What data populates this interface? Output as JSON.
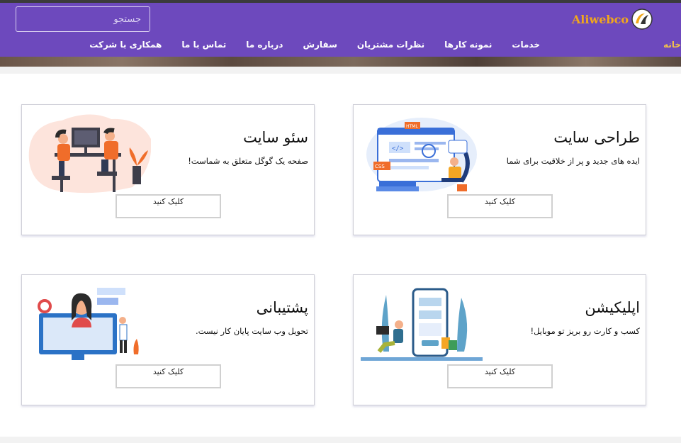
{
  "search": {
    "placeholder": "جستجو"
  },
  "logo": {
    "text": "Aliwebco"
  },
  "nav": {
    "home": "خانه",
    "items": [
      "خدمات",
      "نمونه کارها",
      "نظرات مشتریان",
      "سفارش",
      "درباره ما",
      "تماس با ما",
      "همکاری با شرکت"
    ]
  },
  "cards": [
    {
      "title": "طراحی سایت",
      "desc": "ایده های جدید و پر از خلاقیت برای شما",
      "button": "کلیک کنید",
      "image": "web-design-illustration"
    },
    {
      "title": "سئو سایت",
      "desc": "صفحه یک گوگل متعلق به شماست!",
      "button": "کلیک کنید",
      "image": "seo-team-illustration"
    },
    {
      "title": "اپلیکیشن",
      "desc": "کسب و کارت رو بریز تو موبایل!",
      "button": "کلیک کنید",
      "image": "mobile-app-illustration"
    },
    {
      "title": "پشتیبانی",
      "desc": "تحویل وب سایت پایان کار نیست.",
      "button": "کلیک کنید",
      "image": "support-agent-illustration"
    }
  ],
  "colors": {
    "header": "#6d49bd",
    "logo": "#f2a71b",
    "active_nav": "#f3c24a"
  }
}
